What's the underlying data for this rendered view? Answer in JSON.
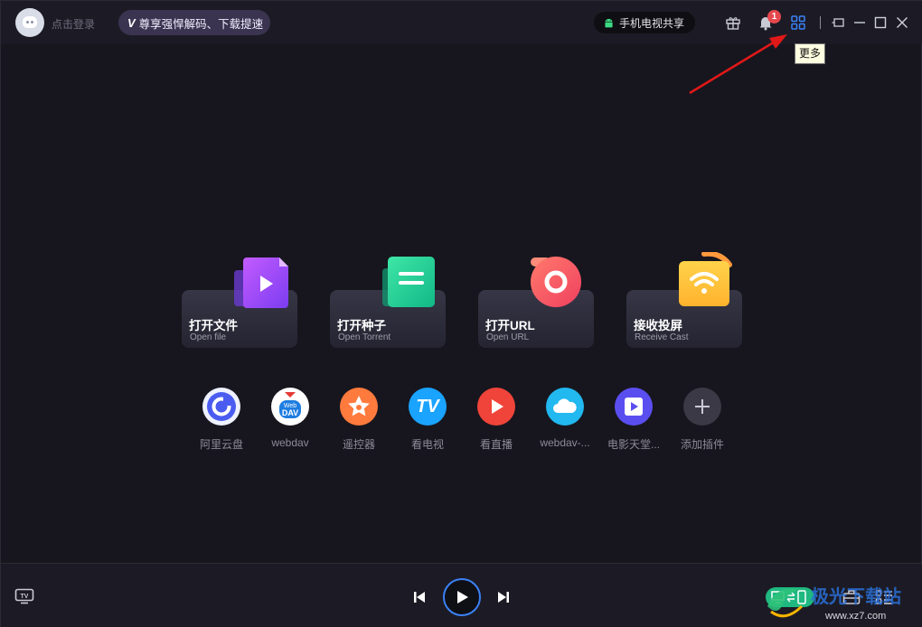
{
  "header": {
    "login_text": "点击登录",
    "vip_text": "尊享强悍解码、下载提速",
    "share_text": "手机电视共享",
    "notification_count": "1",
    "tooltip_text": "更多",
    "icons": [
      "gift-icon",
      "bell-icon",
      "grid-more-icon",
      "minimize-icon",
      "maximize-icon",
      "close-icon"
    ]
  },
  "cards": [
    {
      "title": "打开文件",
      "sub": "Open file"
    },
    {
      "title": "打开种子",
      "sub": "Open Torrent"
    },
    {
      "title": "打开URL",
      "sub": "Open URL"
    },
    {
      "title": "接收投屏",
      "sub": "Receive Cast"
    }
  ],
  "plugins": [
    {
      "label": "阿里云盘",
      "color": "#4a5cf0"
    },
    {
      "label": "webdav",
      "color": "#ffffff"
    },
    {
      "label": "遥控器",
      "color": "#ff7a3d"
    },
    {
      "label": "看电视",
      "color": "#1aa3ff"
    },
    {
      "label": "看直播",
      "color": "#f0443a"
    },
    {
      "label": "webdav-...",
      "color": "#22b8f0"
    },
    {
      "label": "电影天堂...",
      "color": "#5b4ef0"
    },
    {
      "label": "添加插件",
      "color": "#3a3945"
    }
  ],
  "plugin_icon_text": {
    "webdav_top": "Web",
    "webdav_bottom": "DAV",
    "tv": "TV"
  },
  "footer": {
    "tv_icon_text": "TV",
    "watermark": "极光下载站",
    "watermark_url": "www.xz7.com"
  },
  "colors": {
    "accent": "#3b82f6",
    "tooltip_bg": "#ffffe1",
    "arrow": "#e01818"
  }
}
